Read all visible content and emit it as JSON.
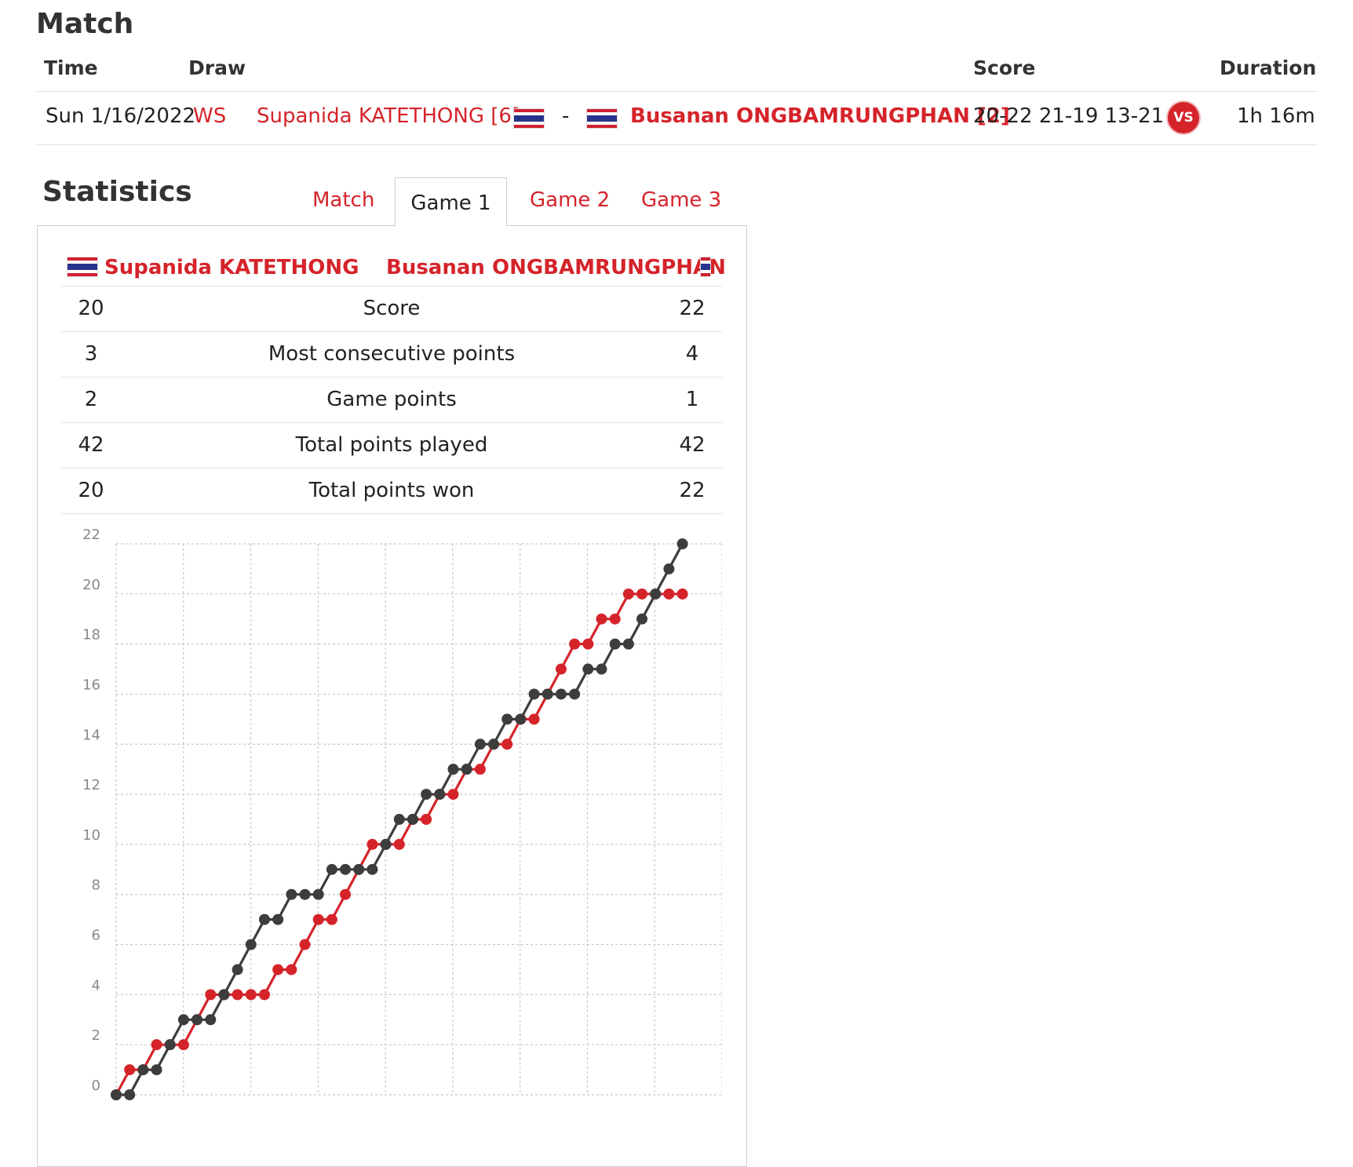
{
  "match_section": {
    "heading": "Match",
    "columns": {
      "time": "Time",
      "draw": "Draw",
      "score": "Score",
      "duration": "Duration"
    },
    "row": {
      "date": "Sun 1/16/2022",
      "draw": "WS",
      "player1": "Supanida KATETHONG [6]",
      "separator": "-",
      "player2": "Busanan ONGBAMRUNGPHAN [2]",
      "score": "20-22 21-19 13-21",
      "vs_label": "VS",
      "duration": "1h 16m"
    }
  },
  "statistics": {
    "heading": "Statistics",
    "tabs": [
      {
        "label": "Match",
        "active": false
      },
      {
        "label": "Game 1",
        "active": true
      },
      {
        "label": "Game 2",
        "active": false
      },
      {
        "label": "Game 3",
        "active": false
      }
    ],
    "player1": "Supanida KATETHONG",
    "player2": "Busanan ONGBAMRUNGPHAN",
    "rows": [
      {
        "left": "20",
        "label": "Score",
        "right": "22"
      },
      {
        "left": "3",
        "label": "Most consecutive points",
        "right": "4"
      },
      {
        "left": "2",
        "label": "Game points",
        "right": "1"
      },
      {
        "left": "42",
        "label": "Total points played",
        "right": "42"
      },
      {
        "left": "20",
        "label": "Total points won",
        "right": "22"
      }
    ]
  },
  "colors": {
    "accent": "#d5232a",
    "player2_line": "#3d3d3d",
    "grid": "#c8c8c8"
  },
  "chart_data": {
    "type": "line",
    "ylim": [
      0,
      22
    ],
    "y_ticks": [
      0,
      2,
      4,
      6,
      8,
      10,
      12,
      14,
      16,
      18,
      20,
      22
    ],
    "x": [
      0,
      1,
      2,
      3,
      4,
      5,
      6,
      7,
      8,
      9,
      10,
      11,
      12,
      13,
      14,
      15,
      16,
      17,
      18,
      19,
      20,
      21,
      22,
      23,
      24,
      25,
      26,
      27,
      28,
      29,
      30,
      31,
      32,
      33,
      34,
      35,
      36,
      37,
      38,
      39,
      40,
      41,
      42
    ],
    "series": [
      {
        "color": "#d5232a",
        "values": [
          0,
          1,
          1,
          2,
          2,
          2,
          3,
          4,
          4,
          4,
          4,
          4,
          5,
          5,
          6,
          7,
          7,
          8,
          9,
          10,
          10,
          10,
          11,
          11,
          12,
          12,
          13,
          13,
          14,
          14,
          15,
          15,
          16,
          17,
          18,
          18,
          19,
          19,
          20,
          20,
          20,
          20,
          20
        ]
      },
      {
        "color": "#3d3d3d",
        "values": [
          0,
          0,
          1,
          1,
          2,
          3,
          3,
          3,
          4,
          5,
          6,
          7,
          7,
          8,
          8,
          8,
          9,
          9,
          9,
          9,
          10,
          11,
          11,
          12,
          12,
          13,
          13,
          14,
          14,
          15,
          15,
          16,
          16,
          16,
          16,
          17,
          17,
          18,
          18,
          19,
          20,
          21,
          22
        ]
      }
    ]
  }
}
